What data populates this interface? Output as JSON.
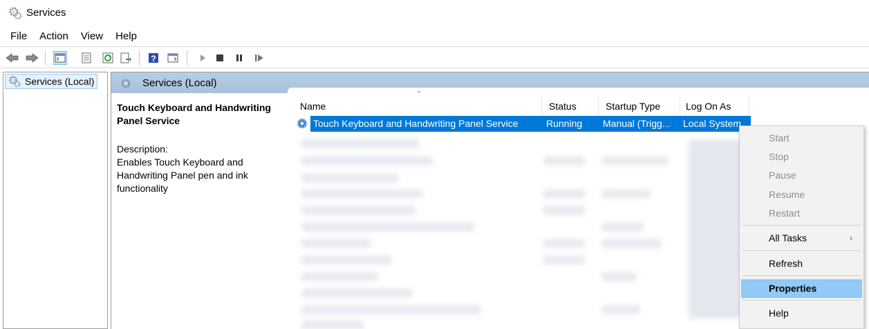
{
  "window": {
    "title": "Services"
  },
  "menu": [
    "File",
    "Action",
    "View",
    "Help"
  ],
  "toolbar": {
    "icons": [
      "back-arrow-icon",
      "forward-arrow-icon",
      "show-hide-console-tree-icon",
      "properties-sheet-icon",
      "refresh-icon",
      "export-list-icon",
      "help-icon",
      "show-action-pane-icon",
      "start-service-icon",
      "stop-service-icon",
      "pause-service-icon",
      "restart-service-icon"
    ]
  },
  "tree": {
    "root_label": "Services (Local)"
  },
  "pane_header": {
    "title": "Services (Local)"
  },
  "description": {
    "service_name": "Touch Keyboard and Handwriting Panel Service",
    "label": "Description:",
    "text": "Enables Touch Keyboard and Handwriting Panel pen and ink functionality"
  },
  "table": {
    "columns": [
      "Name",
      "Status",
      "Startup Type",
      "Log On As"
    ],
    "selected_row": {
      "name": "Touch Keyboard and Handwriting Panel Service",
      "status": "Running",
      "startup_type": "Manual (Trigg...",
      "log_on_as": "Local System"
    }
  },
  "context_menu": {
    "items": [
      {
        "label": "Start",
        "enabled": false
      },
      {
        "label": "Stop",
        "enabled": false
      },
      {
        "label": "Pause",
        "enabled": false
      },
      {
        "label": "Resume",
        "enabled": false
      },
      {
        "label": "Restart",
        "enabled": false
      },
      {
        "label": "All Tasks",
        "enabled": true,
        "submenu_arrow": "›"
      },
      {
        "label": "Refresh",
        "enabled": true
      },
      {
        "label": "Properties",
        "enabled": true,
        "highlighted": true
      },
      {
        "label": "Help",
        "enabled": true
      }
    ]
  },
  "colors": {
    "selection": "#0078d7",
    "header_band": "#b7cde4",
    "menu_highlight": "#91c9f7"
  }
}
